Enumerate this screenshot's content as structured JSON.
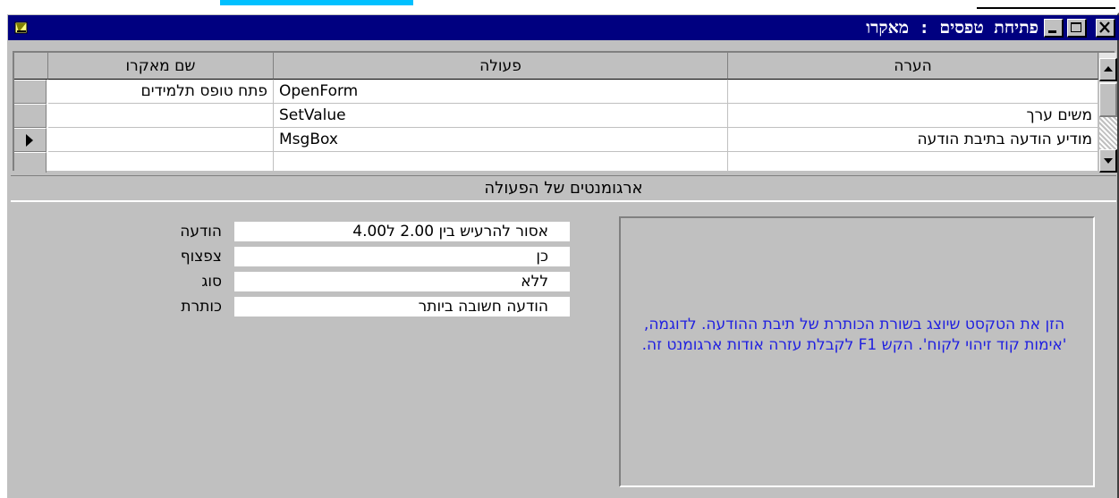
{
  "window": {
    "title": "פתיחת טפסים : מאקרו"
  },
  "grid": {
    "columns": {
      "macro_name": "שם מאקרו",
      "action": "פעולה",
      "comment": "הערה"
    },
    "rows": [
      {
        "macro_name": "פתח טופס תלמידים",
        "action": "OpenForm",
        "comment": ""
      },
      {
        "macro_name": "",
        "action": "SetValue",
        "comment": "משים ערך"
      },
      {
        "macro_name": "",
        "action": "MsgBox",
        "comment": "מודיע הודעה בתיבת הודעה"
      },
      {
        "macro_name": "",
        "action": "",
        "comment": ""
      }
    ],
    "current_row": 2
  },
  "arguments": {
    "header": "ארגומנטים של הפעולה",
    "items": [
      {
        "label": "הודעה",
        "value": "אסור להרעיש בין 2.00 ל4.00"
      },
      {
        "label": "צפצוף",
        "value": "כן"
      },
      {
        "label": "סוג",
        "value": "ללא"
      },
      {
        "label": "כותרת",
        "value": "הודעה חשובה ביותר"
      }
    ]
  },
  "help": {
    "text": "הזן את הטקסט שיוצג בשורת הכותרת של תיבת ההודעה. לדוגמה, 'אימות קוד זיהוי לקוח'. הקש F1 לקבלת עזרה אודות ארגומנט זה."
  },
  "colors": {
    "title_bar": "#000080",
    "face": "#c0c0c0",
    "help_text": "#2020e0"
  },
  "icons": {
    "app": "macro-icon",
    "row_pointer": "triangle-right-icon"
  }
}
